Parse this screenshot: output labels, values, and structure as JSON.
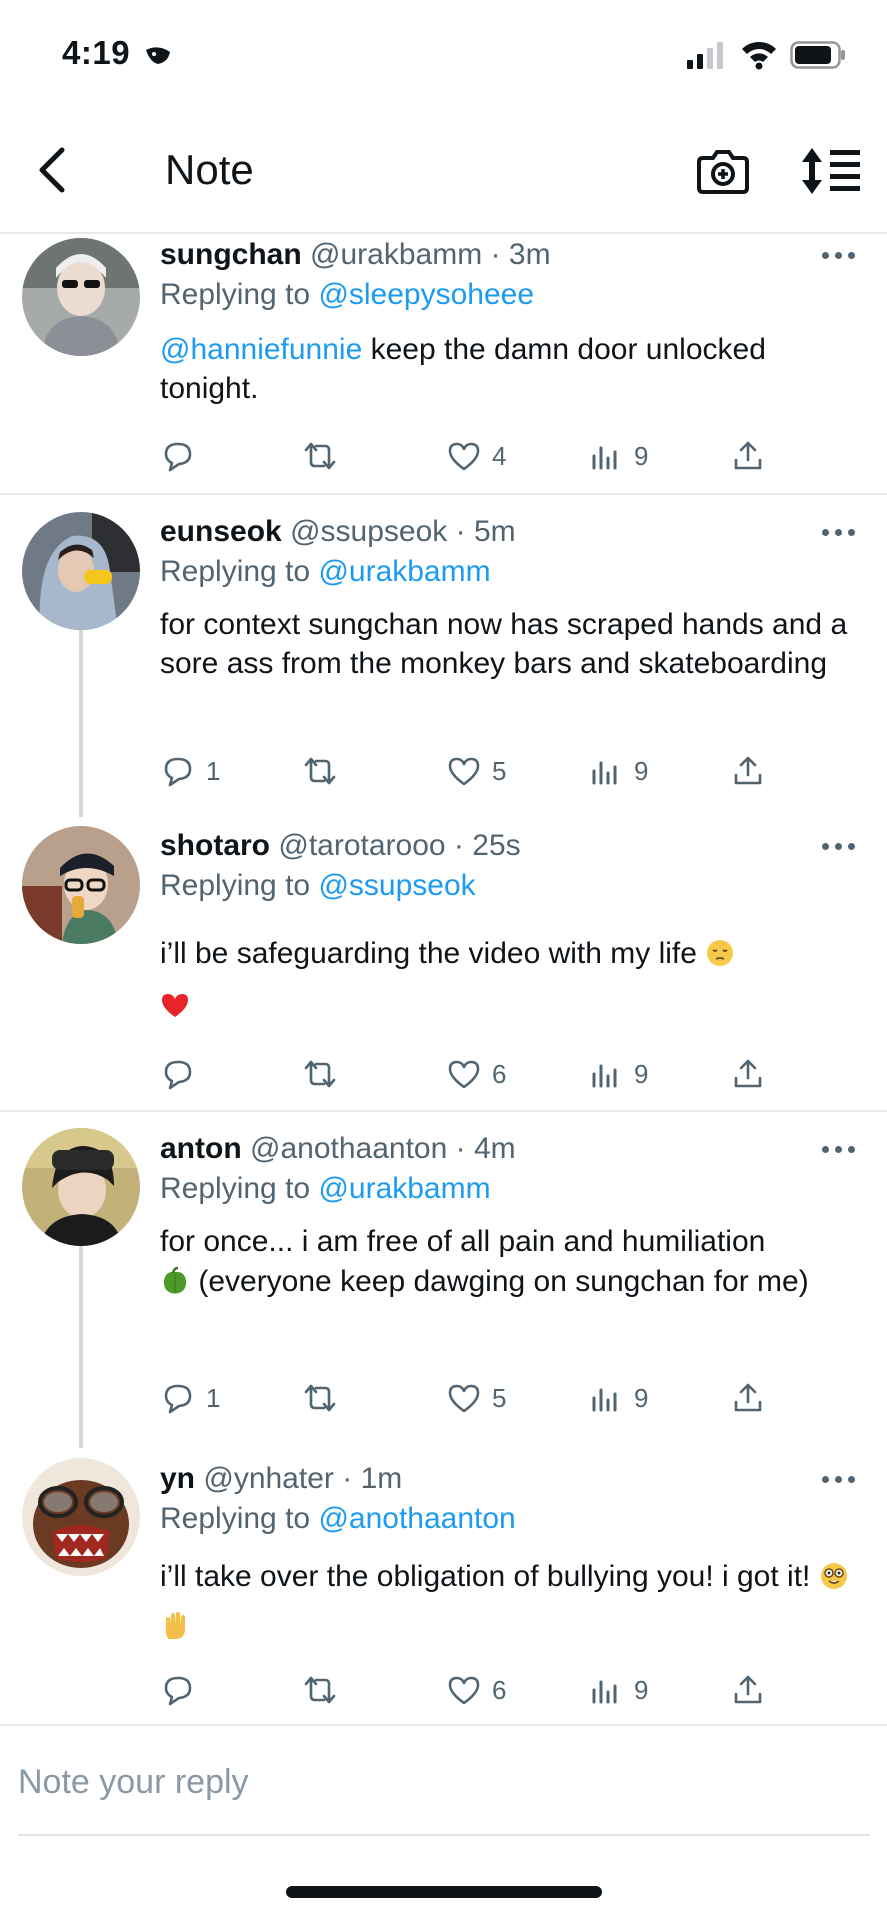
{
  "status_bar": {
    "time": "4:19"
  },
  "header": {
    "title": "Note"
  },
  "tweets": [
    {
      "name": "sungchan",
      "handle": "@urakbamm",
      "time": "3m",
      "replying_label": "Replying to",
      "replying_to": "@sleepysoheee",
      "mention": "@hanniefunnie",
      "text": " keep the damn door unlocked tonight.",
      "counts": {
        "replies": "",
        "likes": "4",
        "views": "9"
      }
    },
    {
      "name": "eunseok",
      "handle": "@ssupseok",
      "time": "5m",
      "replying_label": "Replying to",
      "replying_to": "@urakbamm",
      "text": "for context sungchan now has scraped hands and a sore ass from the monkey bars and skateboarding",
      "counts": {
        "replies": "1",
        "likes": "5",
        "views": "9"
      }
    },
    {
      "name": "shotaro",
      "handle": "@tarotarooo",
      "time": "25s",
      "replying_label": "Replying to",
      "replying_to": "@ssupseok",
      "text": "i’ll be safeguarding the video with my life",
      "counts": {
        "replies": "",
        "likes": "6",
        "views": "9"
      }
    },
    {
      "name": "anton",
      "handle": "@anothaanton",
      "time": "4m",
      "replying_label": "Replying to",
      "replying_to": "@urakbamm",
      "text_line1": "for once... i am free of all pain and humiliation",
      "text_line2": " (everyone keep dawging on sungchan for me)",
      "counts": {
        "replies": "1",
        "likes": "5",
        "views": "9"
      }
    },
    {
      "name": "yn",
      "handle": "@ynhater",
      "time": "1m",
      "replying_label": "Replying to",
      "replying_to": "@anothaanton",
      "text": "i’ll take over the obligation of bullying you! i got it!",
      "counts": {
        "replies": "",
        "likes": "6",
        "views": "9"
      }
    }
  ],
  "reply_bar": {
    "placeholder": "Note your reply"
  },
  "colors": {
    "accent": "#1d9bf0",
    "secondary_text": "#536471",
    "divider": "#e6e8ea"
  },
  "icons": [
    "back-arrow-icon",
    "camera-icon",
    "sort-icon",
    "reply-icon",
    "retweet-icon",
    "like-icon",
    "views-icon",
    "share-icon",
    "more-icon"
  ]
}
